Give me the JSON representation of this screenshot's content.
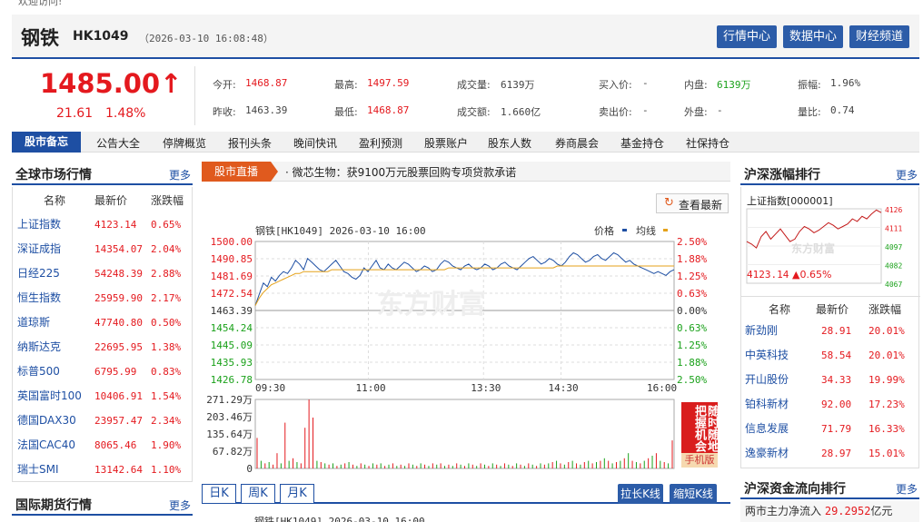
{
  "top": {
    "welcome": "欢迎访问!"
  },
  "header": {
    "name": "钢铁",
    "code": "HK1049",
    "time": "（2026-03-10 16:08:48）",
    "buttons": [
      "行情中心",
      "数据中心",
      "财经频道"
    ]
  },
  "quote": {
    "price": "1485.00",
    "arrow": "↑",
    "change": "21.61",
    "pct": "1.48%",
    "stats": [
      {
        "label": "今开:",
        "value": "1468.87",
        "color": "red"
      },
      {
        "label": "最高:",
        "value": "1497.59",
        "color": "red"
      },
      {
        "label": "成交量:",
        "value": "6139万",
        "color": "plain"
      },
      {
        "label": "买入价:",
        "value": "-",
        "color": "plain"
      },
      {
        "label": "内盘:",
        "value": "6139万",
        "color": "green"
      },
      {
        "label": "振幅:",
        "value": "1.96%",
        "color": "plain"
      },
      {
        "label": "昨收:",
        "value": "1463.39",
        "color": "plain"
      },
      {
        "label": "最低:",
        "value": "1468.87",
        "color": "red"
      },
      {
        "label": "成交额:",
        "value": "1.660亿",
        "color": "plain"
      },
      {
        "label": "卖出价:",
        "value": "-",
        "color": "plain"
      },
      {
        "label": "外盘:",
        "value": "-",
        "color": "plain"
      },
      {
        "label": "量比:",
        "value": "0.74",
        "color": "plain"
      }
    ]
  },
  "nav": {
    "first": "股市备忘",
    "items": [
      "公告大全",
      "停牌概览",
      "报刊头条",
      "晚间快讯",
      "盈利预测",
      "股票账户",
      "股东人数",
      "券商晨会",
      "基金持仓",
      "社保持仓"
    ]
  },
  "global": {
    "title": "全球市场行情",
    "more": "更多",
    "cols": [
      "名称",
      "最新价",
      "涨跌幅"
    ],
    "rows": [
      [
        "上证指数",
        "4123.14",
        "0.65%"
      ],
      [
        "深证成指",
        "14354.07",
        "2.04%"
      ],
      [
        "日经225",
        "54248.39",
        "2.88%"
      ],
      [
        "恒生指数",
        "25959.90",
        "2.17%"
      ],
      [
        "道琼斯",
        "47740.80",
        "0.50%"
      ],
      [
        "纳斯达克",
        "22695.95",
        "1.38%"
      ],
      [
        "标普500",
        "6795.99",
        "0.83%"
      ],
      [
        "英国富时100",
        "10406.91",
        "1.54%"
      ],
      [
        "德国DAX30",
        "23957.47",
        "2.34%"
      ],
      [
        "法国CAC40",
        "8065.46",
        "1.90%"
      ],
      [
        "瑞士SMI",
        "13142.64",
        "1.10%"
      ]
    ]
  },
  "futures": {
    "title": "国际期货行情",
    "more": "更多"
  },
  "live": {
    "label": "股市直播",
    "news": "· 微芯生物：获9100万元股票回购专项贷款承诺"
  },
  "refresh": {
    "label": "查看最新"
  },
  "chart_data": {
    "type": "line",
    "title": "钢铁[HK1049] 2026-03-10 16:00",
    "legend": [
      "价格",
      "均线"
    ],
    "ylabels_left": [
      "1500.00",
      "1490.85",
      "1481.69",
      "1472.54",
      "1463.39",
      "1454.24",
      "1445.09",
      "1435.93",
      "1426.78"
    ],
    "ylabels_right": [
      "2.50%",
      "1.88%",
      "1.25%",
      "0.63%",
      "0.00%",
      "0.63%",
      "1.25%",
      "1.88%",
      "2.50%"
    ],
    "xlabels": [
      "09:30",
      "11:00",
      "13:30",
      "14:30",
      "16:00"
    ],
    "ylim": [
      1426.78,
      1500.0
    ],
    "vol_labels": [
      "271.29万",
      "203.46万",
      "135.64万",
      "67.82万",
      "0"
    ],
    "price": [
      1466,
      1472,
      1478,
      1476,
      1481,
      1479,
      1482,
      1484,
      1483,
      1486,
      1490,
      1488,
      1485,
      1491,
      1489,
      1487,
      1485,
      1484,
      1486,
      1488,
      1490,
      1487,
      1484,
      1483,
      1481,
      1480,
      1482,
      1486,
      1484,
      1487,
      1490,
      1486,
      1485,
      1488,
      1486,
      1485,
      1487,
      1489,
      1488,
      1486,
      1484,
      1485,
      1487,
      1486,
      1484,
      1485,
      1488,
      1490,
      1489,
      1487,
      1486,
      1485,
      1487,
      1488,
      1486,
      1485,
      1486,
      1488,
      1487,
      1485,
      1486,
      1488,
      1489,
      1487,
      1486,
      1485,
      1487,
      1489,
      1491,
      1492,
      1490,
      1488,
      1489,
      1491,
      1490,
      1488,
      1487,
      1489,
      1492,
      1494,
      1493,
      1491,
      1489,
      1490,
      1492,
      1493,
      1491,
      1490,
      1492,
      1494,
      1493,
      1491,
      1489,
      1490,
      1488,
      1487,
      1486,
      1485,
      1484,
      1483,
      1484,
      1483,
      1482,
      1484,
      1485
    ],
    "avg": [
      1466,
      1470,
      1473,
      1475,
      1477,
      1478,
      1479,
      1480,
      1481,
      1482,
      1483,
      1483,
      1484,
      1484,
      1484,
      1484,
      1484,
      1484,
      1484,
      1485,
      1485,
      1485,
      1485,
      1485,
      1485,
      1485,
      1485,
      1485,
      1485,
      1485,
      1485,
      1485,
      1485,
      1485,
      1485,
      1485,
      1485,
      1485,
      1485,
      1485,
      1485,
      1485,
      1485,
      1485,
      1485,
      1485,
      1485,
      1485,
      1486,
      1486,
      1486,
      1486,
      1486,
      1486,
      1486,
      1486,
      1486,
      1486,
      1486,
      1486,
      1486,
      1486,
      1486,
      1486,
      1486,
      1486,
      1486,
      1486,
      1486,
      1486,
      1486,
      1486,
      1486,
      1486,
      1486,
      1487,
      1487,
      1487,
      1487,
      1487,
      1487,
      1487,
      1487,
      1487,
      1487,
      1487,
      1487,
      1487,
      1487,
      1487,
      1487,
      1487,
      1487,
      1487,
      1487,
      1487,
      1487,
      1487,
      1487,
      1487,
      1487,
      1487,
      1487,
      1487,
      1487
    ],
    "volume": [
      120,
      30,
      20,
      25,
      15,
      60,
      20,
      180,
      30,
      40,
      25,
      20,
      160,
      271,
      200,
      30,
      25,
      20,
      15,
      20,
      10,
      15,
      20,
      25,
      15,
      10,
      20,
      15,
      10,
      20,
      15,
      20,
      10,
      15,
      20,
      10,
      15,
      10,
      20,
      15,
      10,
      20,
      15,
      10,
      20,
      15,
      20,
      10,
      15,
      10,
      20,
      15,
      10,
      20,
      15,
      10,
      20,
      15,
      10,
      20,
      15,
      10,
      20,
      15,
      10,
      20,
      15,
      10,
      20,
      15,
      10,
      20,
      15,
      20,
      25,
      30,
      20,
      15,
      25,
      30,
      20,
      15,
      25,
      30,
      20,
      25,
      30,
      40,
      30,
      20,
      25,
      30,
      40,
      60,
      30,
      25,
      20,
      30,
      40,
      50,
      60,
      30,
      25,
      20,
      110
    ],
    "vol_colors": [
      "r",
      "g",
      "r",
      "g",
      "r",
      "r",
      "g",
      "r",
      "g",
      "r",
      "g",
      "r",
      "r",
      "r",
      "r",
      "g",
      "r",
      "g",
      "r",
      "g",
      "r",
      "g",
      "r",
      "g",
      "r",
      "g",
      "r",
      "g",
      "r",
      "g",
      "r",
      "g",
      "r",
      "g",
      "r",
      "g",
      "r",
      "g",
      "r",
      "g",
      "r",
      "g",
      "r",
      "g",
      "r",
      "g",
      "r",
      "g",
      "r",
      "g",
      "r",
      "g",
      "r",
      "g",
      "r",
      "g",
      "r",
      "g",
      "r",
      "g",
      "r",
      "g",
      "r",
      "g",
      "r",
      "g",
      "r",
      "g",
      "r",
      "g",
      "r",
      "g",
      "r",
      "g",
      "r",
      "g",
      "r",
      "g",
      "r",
      "g",
      "r",
      "g",
      "r",
      "g",
      "r",
      "g",
      "r",
      "g",
      "r",
      "g",
      "r",
      "g",
      "r",
      "g",
      "r",
      "g",
      "r",
      "g",
      "r",
      "g",
      "r",
      "g",
      "r",
      "g",
      "r"
    ]
  },
  "promo": {
    "text": "随时随地 把握机会",
    "sub": "手机版"
  },
  "tabs": {
    "items": [
      "日K",
      "周K",
      "月K"
    ],
    "btns": [
      "拉长K线",
      "缩短K线"
    ],
    "footer": "钢铁[HK1049] 2026-03-10 16:00"
  },
  "rank": {
    "title": "沪深涨幅排行",
    "more": "更多",
    "mini": "上证指数[000001]",
    "mini_y": [
      "4126",
      "4111",
      "4097",
      "4082",
      "4067"
    ],
    "mini_price": "4123.14",
    "mini_pct": "▲0.65%",
    "watermark": "东方财富",
    "mini_line": [
      4100,
      4098,
      4095,
      4104,
      4108,
      4102,
      4106,
      4110,
      4105,
      4100,
      4102,
      4108,
      4112,
      4110,
      4107,
      4109,
      4112,
      4115,
      4113,
      4110,
      4112,
      4114,
      4118,
      4116,
      4120,
      4118,
      4122,
      4125,
      4123
    ],
    "cols": [
      "名称",
      "最新价",
      "涨跌幅"
    ],
    "rows": [
      [
        "新劲刚",
        "28.91",
        "20.01%"
      ],
      [
        "中英科技",
        "58.54",
        "20.01%"
      ],
      [
        "开山股份",
        "34.33",
        "19.99%"
      ],
      [
        "铂科新材",
        "92.00",
        "17.23%"
      ],
      [
        "信息发展",
        "71.79",
        "16.33%"
      ],
      [
        "逸豪新材",
        "28.97",
        "15.01%"
      ]
    ]
  },
  "flow": {
    "title": "沪深资金流向排行",
    "more": "更多",
    "label": "两市主力净流入",
    "value": "29.2952",
    "unit": "亿元"
  },
  "watermark": "东方财富",
  "colors": {
    "accent": "#1e4fa3",
    "up": "#e4191e",
    "down": "#1aa11a",
    "live": "#e05a1e"
  }
}
